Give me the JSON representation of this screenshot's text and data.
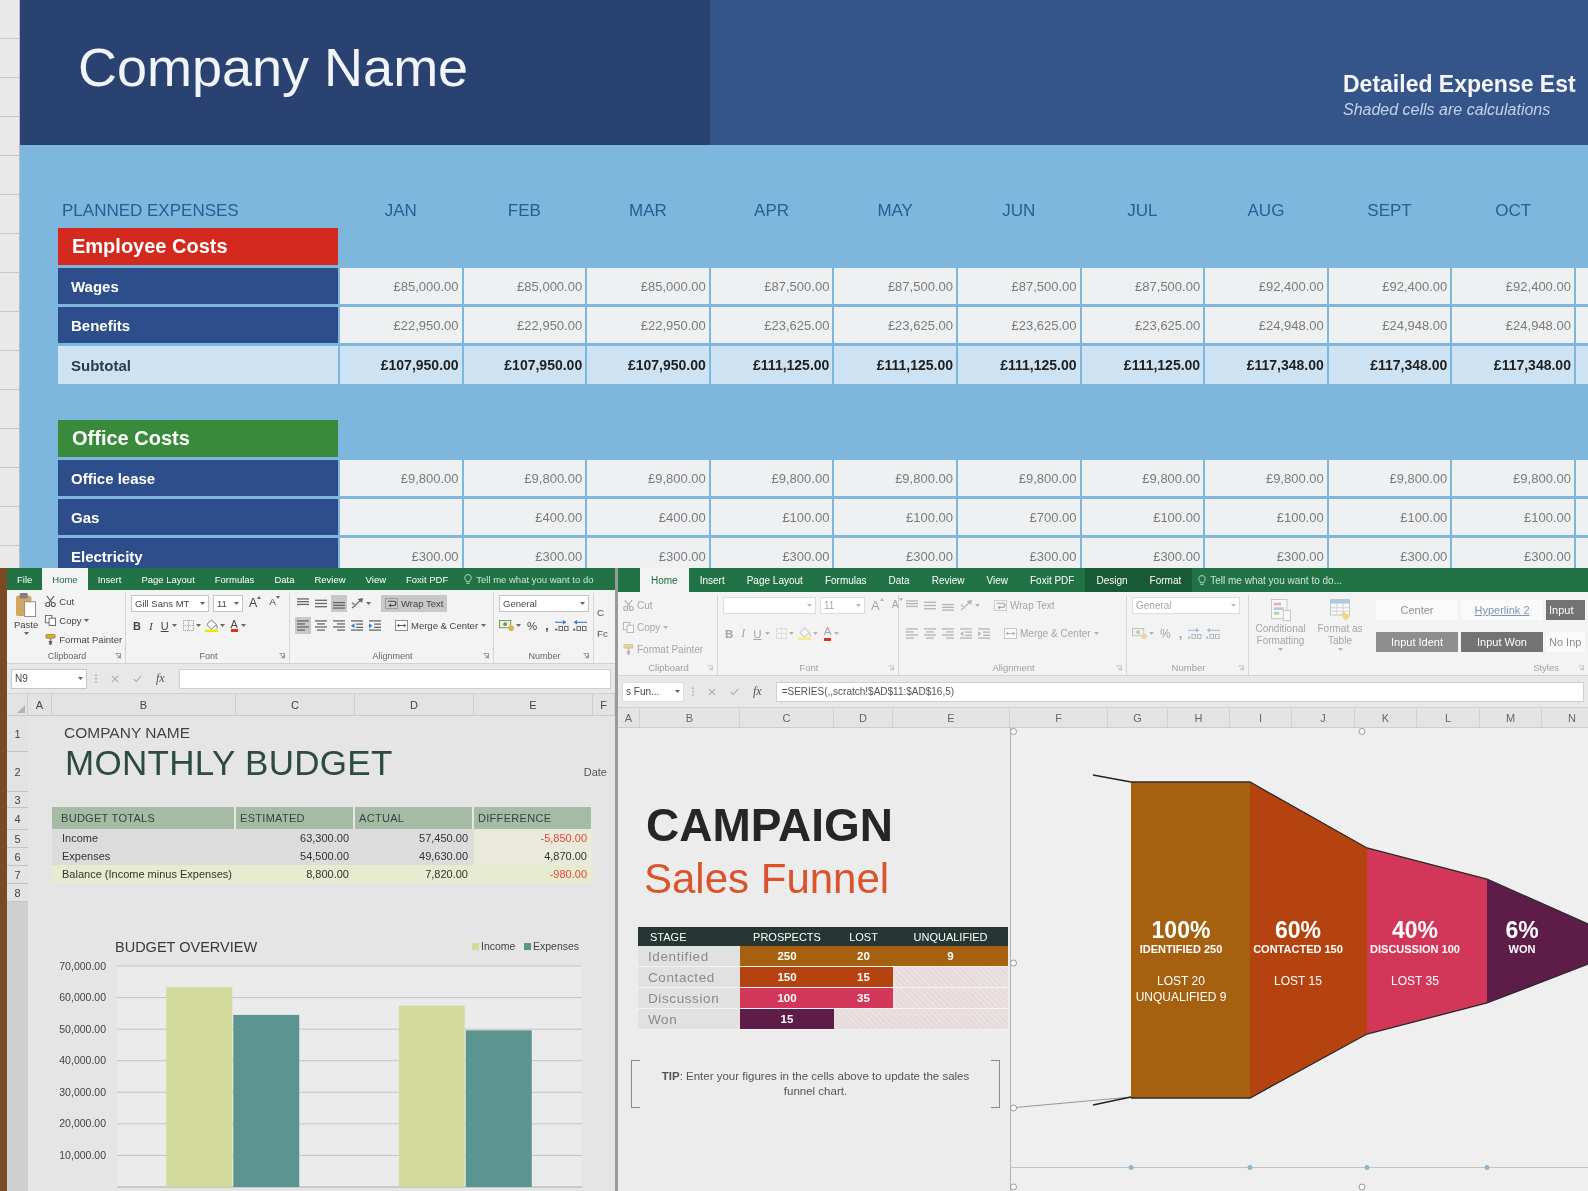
{
  "expense_sheet": {
    "title": "Company Name",
    "heading": "Detailed Expense Est",
    "note": "Shaded cells are calculations",
    "corner_label": "PLANNED EXPENSES",
    "months": [
      "JAN",
      "FEB",
      "MAR",
      "APR",
      "MAY",
      "JUN",
      "JUL",
      "AUG",
      "SEPT",
      "OCT"
    ],
    "sections": [
      {
        "title": "Employee Costs",
        "color": "#d4291f",
        "rows": [
          {
            "label": "Wages",
            "kind": "item",
            "leading_blank": false,
            "values": [
              "£85,000.00",
              "£85,000.00",
              "£85,000.00",
              "£87,500.00",
              "£87,500.00",
              "£87,500.00",
              "£87,500.00",
              "£92,400.00",
              "£92,400.00",
              "£92,400.00"
            ]
          },
          {
            "label": "Benefits",
            "kind": "item",
            "leading_blank": false,
            "values": [
              "£22,950.00",
              "£22,950.00",
              "£22,950.00",
              "£23,625.00",
              "£23,625.00",
              "£23,625.00",
              "£23,625.00",
              "£24,948.00",
              "£24,948.00",
              "£24,948.00"
            ]
          },
          {
            "label": "Subtotal",
            "kind": "subtotal",
            "leading_blank": false,
            "values": [
              "£107,950.00",
              "£107,950.00",
              "£107,950.00",
              "£111,125.00",
              "£111,125.00",
              "£111,125.00",
              "£111,125.00",
              "£117,348.00",
              "£117,348.00",
              "£117,348.00"
            ]
          }
        ]
      },
      {
        "title": "Office Costs",
        "color": "#3a8a3c",
        "rows": [
          {
            "label": "Office lease",
            "kind": "item",
            "leading_blank": false,
            "values": [
              "£9,800.00",
              "£9,800.00",
              "£9,800.00",
              "£9,800.00",
              "£9,800.00",
              "£9,800.00",
              "£9,800.00",
              "£9,800.00",
              "£9,800.00",
              "£9,800.00"
            ]
          },
          {
            "label": "Gas",
            "kind": "item",
            "leading_blank": true,
            "values": [
              "£400.00",
              "£400.00",
              "£100.00",
              "£100.00",
              "£700.00",
              "£100.00",
              "£100.00",
              "£100.00",
              "£100.00"
            ]
          },
          {
            "label": "Electricity",
            "kind": "item",
            "leading_blank": false,
            "values": [
              "£300.00",
              "£300.00",
              "£300.00",
              "£300.00",
              "£300.00",
              "£300.00",
              "£300.00",
              "£300.00",
              "£300.00",
              "£300.00"
            ]
          }
        ]
      }
    ]
  },
  "budget_window": {
    "active": true,
    "ribbon": {
      "tabs": [
        {
          "label": "File",
          "selected": false
        },
        {
          "label": "Home",
          "selected": true
        },
        {
          "label": "Insert",
          "selected": false
        },
        {
          "label": "Page Layout",
          "selected": false
        },
        {
          "label": "Formulas",
          "selected": false
        },
        {
          "label": "Data",
          "selected": false
        },
        {
          "label": "Review",
          "selected": false
        },
        {
          "label": "View",
          "selected": false
        },
        {
          "label": "Foxit PDF",
          "selected": false
        }
      ],
      "tell_me": "Tell me what you want to do",
      "groups": [
        {
          "kind": "clipboard",
          "label": "Clipboard",
          "paste": "Paste",
          "cut": "Cut",
          "copy": "Copy",
          "format_painter": "Format Painter"
        },
        {
          "kind": "font",
          "label": "Font",
          "font_name": "Gill Sans MT",
          "font_size": "11",
          "grow": "A",
          "shrink": "A",
          "bold": "B",
          "italic": "I",
          "underline": "U",
          "font_color": "A"
        },
        {
          "kind": "alignment",
          "label": "Alignment",
          "rows": [
            {
              "buttons": [
                {
                  "kind": "top",
                  "on": false
                },
                {
                  "kind": "middle",
                  "on": false
                },
                {
                  "kind": "bottom",
                  "on": true
                },
                {
                  "kind": "orientation",
                  "on": false
                }
              ],
              "action": {
                "kind": "wrap",
                "label": "Wrap Text",
                "on": true
              }
            },
            {
              "buttons": [
                {
                  "kind": "left",
                  "on": true
                },
                {
                  "kind": "center",
                  "on": false
                },
                {
                  "kind": "right",
                  "on": false
                },
                {
                  "kind": "outdent",
                  "on": false
                },
                {
                  "kind": "indent",
                  "on": false
                }
              ],
              "action": {
                "kind": "merge",
                "label": "Merge & Center",
                "on": false
              }
            }
          ]
        },
        {
          "kind": "number",
          "label": "Number",
          "format": "General",
          "percent": "%",
          "comma": ","
        },
        {
          "kind": "partial",
          "lines": [
            "C",
            "Fc"
          ]
        }
      ]
    },
    "formula_bar": {
      "name_box": "N9",
      "function_label": "fx"
    },
    "columns": [
      "A",
      "B",
      "C",
      "D",
      "E",
      "F"
    ],
    "row_numbers": [
      "1",
      "2",
      "3",
      "4",
      "5",
      "6",
      "7",
      "8"
    ],
    "company": "COMPANY NAME",
    "title": "MONTHLY BUDGET",
    "date_label": "Date",
    "totals": {
      "columns": [
        "BUDGET TOTALS",
        "ESTIMATED",
        "ACTUAL",
        "DIFFERENCE"
      ],
      "rows": [
        {
          "label": "Income",
          "kind": "item",
          "estimated": "63,300.00",
          "actual": "57,450.00",
          "difference": "-5,850.00",
          "negative": true
        },
        {
          "label": "Expenses",
          "kind": "item",
          "estimated": "54,500.00",
          "actual": "49,630.00",
          "difference": "4,870.00",
          "negative": false
        },
        {
          "label": "Balance (Income minus Expenses)",
          "kind": "balance",
          "estimated": "8,800.00",
          "actual": "7,820.00",
          "difference": "-980.00",
          "negative": true
        }
      ]
    },
    "chart_data": {
      "type": "bar",
      "title": "BUDGET OVERVIEW",
      "series": [
        {
          "name": "Income",
          "color": "#d3db9c",
          "values": [
            63300,
            57450
          ]
        },
        {
          "name": "Expenses",
          "color": "#5b9590",
          "values": [
            54500,
            49630
          ]
        }
      ],
      "ylim": [
        0,
        70000
      ],
      "yticks": [
        {
          "value": 10000,
          "label": "10,000.00"
        },
        {
          "value": 20000,
          "label": "20,000.00"
        },
        {
          "value": 30000,
          "label": "30,000.00"
        },
        {
          "value": 40000,
          "label": "40,000.00"
        },
        {
          "value": 50000,
          "label": "50,000.00"
        },
        {
          "value": 60000,
          "label": "60,000.00"
        },
        {
          "value": 70000,
          "label": "70,000.00"
        }
      ],
      "grid": true,
      "legend": "top-right"
    }
  },
  "funnel_window": {
    "active": false,
    "ribbon": {
      "tabs": [
        {
          "label": "Home",
          "kind": "standard",
          "selected": true
        },
        {
          "label": "Insert",
          "kind": "standard",
          "selected": false
        },
        {
          "label": "Page Layout",
          "kind": "standard",
          "selected": false
        },
        {
          "label": "Formulas",
          "kind": "standard",
          "selected": false
        },
        {
          "label": "Data",
          "kind": "standard",
          "selected": false
        },
        {
          "label": "Review",
          "kind": "standard",
          "selected": false
        },
        {
          "label": "View",
          "kind": "standard",
          "selected": false
        },
        {
          "label": "Foxit PDF",
          "kind": "standard",
          "selected": false
        },
        {
          "label": "Design",
          "kind": "contextual",
          "selected": false
        },
        {
          "label": "Format",
          "kind": "contextual",
          "selected": false
        }
      ],
      "tell_me": "Tell me what you want to do...",
      "groups": [
        {
          "kind": "clipboard",
          "label": "Clipboard",
          "cut": "Cut",
          "copy": "Copy",
          "format_painter": "Format Painter"
        },
        {
          "kind": "font",
          "label": "Font",
          "font_size": "11",
          "grow": "A",
          "shrink": "A",
          "bold": "B",
          "italic": "I",
          "underline": "U",
          "font_color": "A"
        },
        {
          "kind": "alignment",
          "label": "Alignment",
          "rows": [
            {
              "buttons": [
                {
                  "kind": "top",
                  "on": false
                },
                {
                  "kind": "middle",
                  "on": false
                },
                {
                  "kind": "bottom",
                  "on": false
                },
                {
                  "kind": "orientation",
                  "on": false
                }
              ],
              "action": {
                "kind": "wrap",
                "label": "Wrap Text",
                "on": false
              }
            },
            {
              "buttons": [
                {
                  "kind": "left",
                  "on": false
                },
                {
                  "kind": "center",
                  "on": false
                },
                {
                  "kind": "right",
                  "on": false
                },
                {
                  "kind": "outdent",
                  "on": false
                },
                {
                  "kind": "indent",
                  "on": false
                }
              ],
              "action": {
                "kind": "merge",
                "label": "Merge & Center",
                "on": false
              }
            }
          ]
        },
        {
          "kind": "number",
          "label": "Number",
          "format": "General",
          "percent": "%",
          "comma": ","
        },
        {
          "kind": "conditional_formatting",
          "label": "Conditional Formatting"
        },
        {
          "kind": "format_table",
          "label": "Format as Table"
        },
        {
          "kind": "styles",
          "label": "Styles",
          "cells": [
            {
              "label": "Center",
              "kind": "plain"
            },
            {
              "label": "Hyperlink 2",
              "kind": "link"
            },
            {
              "label": "Input",
              "kind": "dark"
            },
            {
              "label": "Input Ident",
              "kind": "muted"
            },
            {
              "label": "Input Won",
              "kind": "dark"
            },
            {
              "label": "No Inp",
              "kind": "plain"
            }
          ]
        }
      ]
    },
    "formula_bar": {
      "name_box": "s Fun...",
      "function_label": "fx",
      "formula": "=SERIES(,,scratch!$AD$11:$AD$16,5)"
    },
    "columns": [
      "A",
      "B",
      "C",
      "D",
      "E",
      "F",
      "G",
      "H",
      "I",
      "J",
      "K",
      "L",
      "M",
      "N"
    ],
    "title": "CAMPAIGN",
    "subtitle": "Sales Funnel",
    "table": {
      "columns": [
        "STAGE",
        "PROSPECTS",
        "LOST",
        "UNQUALIFIED"
      ],
      "rows": [
        {
          "stage": "Identified",
          "color": "#a5610f",
          "prospects": "250",
          "lost": "20",
          "unqualified": "9"
        },
        {
          "stage": "Contacted",
          "color": "#b4430f",
          "prospects": "150",
          "lost": "15"
        },
        {
          "stage": "Discussion",
          "color": "#d23659",
          "prospects": "100",
          "lost": "35"
        },
        {
          "stage": "Won",
          "color": "#5e1c49",
          "prospects": "15"
        }
      ]
    },
    "tip": "**TIP**: Enter your figures in the cells above to update the sales funnel chart.",
    "funnel": {
      "stages": [
        {
          "percent": "100%",
          "label": "IDENTIFIED 250",
          "details": [
            "LOST 20",
            "UNQUALIFIED 9"
          ],
          "color": "#a5610f"
        },
        {
          "percent": "60%",
          "label": "CONTACTED 150",
          "details": [
            "LOST 15"
          ],
          "color": "#b4430f"
        },
        {
          "percent": "40%",
          "label": "DISCUSSION 100",
          "details": [
            "LOST 35"
          ],
          "color": "#d23659"
        },
        {
          "percent": "6%",
          "label": "WON",
          "color": "#5e1c49"
        }
      ]
    }
  }
}
